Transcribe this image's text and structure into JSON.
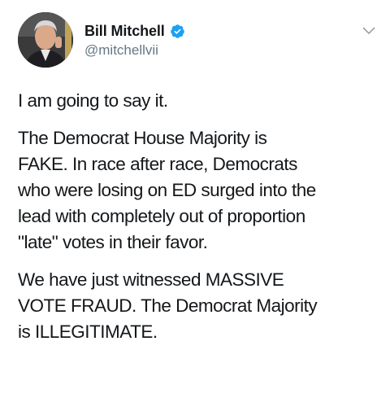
{
  "user": {
    "display_name": "Bill Mitchell",
    "handle": "@mitchellvii",
    "verified": true,
    "avatar_icon": "profile-photo"
  },
  "tweet": {
    "paragraphs": [
      "I am going to say it.",
      "The Democrat House Majority is\nFAKE.  In race after race, Democrats\nwho were losing on ED surged into the\nlead with completely out of proportion\n\"late\" votes in their favor.",
      "We have just witnessed MASSIVE\nVOTE FRAUD.  The Democrat Majority\nis ILLEGITIMATE."
    ]
  },
  "icons": {
    "verified": "verified-badge-icon",
    "menu": "chevron-down-icon"
  },
  "colors": {
    "verified_blue": "#1da1f2",
    "handle_gray": "#657786",
    "text": "#14171a"
  }
}
